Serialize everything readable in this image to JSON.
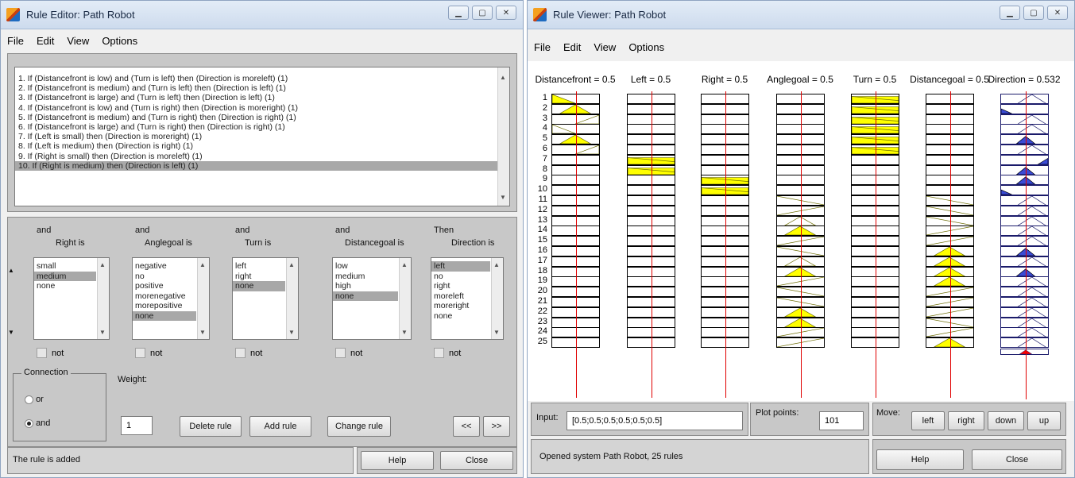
{
  "rule_editor": {
    "title": "Rule Editor: Path Robot",
    "menu": [
      "File",
      "Edit",
      "View",
      "Options"
    ],
    "rules": [
      "1. If (Distancefront is low) and (Turn is left) then (Direction is moreleft) (1)",
      "2. If (Distancefront is medium) and (Turn is left) then (Direction is left) (1)",
      "3. If (Distancefront is large) and (Turn is left) then (Direction is left) (1)",
      "4. If (Distancefront is low) and (Turn is right) then (Direction is moreright) (1)",
      "5. If (Distancefront is medium) and (Turn is right) then (Direction is right) (1)",
      "6. If (Distancefront is large) and (Turn is right) then (Direction is right) (1)",
      "7. If (Left is small) then (Direction is moreright) (1)",
      "8. If (Left is medium) then (Direction is right) (1)",
      "9. If (Right is small) then (Direction is moreleft) (1)",
      "10. If (Right is medium) then (Direction is left) (1)"
    ],
    "selected_rule": 9,
    "columns": [
      {
        "prefix": "and",
        "label": "Right is",
        "options": [
          "small",
          "medium",
          "none"
        ],
        "selected": 1,
        "not": "not"
      },
      {
        "prefix": "and",
        "label": "Anglegoal is",
        "options": [
          "negative",
          "no",
          "positive",
          "morenegative",
          "morepositive",
          "none"
        ],
        "selected": 5,
        "not": "not"
      },
      {
        "prefix": "and",
        "label": "Turn is",
        "options": [
          "left",
          "right",
          "none"
        ],
        "selected": 2,
        "not": "not"
      },
      {
        "prefix": "and",
        "label": "Distancegoal is",
        "options": [
          "low",
          "medium",
          "high",
          "none"
        ],
        "selected": 3,
        "not": "not"
      },
      {
        "prefix": "Then",
        "label": "Direction is",
        "options": [
          "left",
          "no",
          "right",
          "moreleft",
          "moreright",
          "none"
        ],
        "selected": 0,
        "not": "not"
      }
    ],
    "connection_label": "Connection",
    "connection_options": [
      "or",
      "and"
    ],
    "connection_selected": 1,
    "weight_label": "Weight:",
    "weight_value": "1",
    "buttons": {
      "delete": "Delete rule",
      "add": "Add rule",
      "change": "Change rule",
      "prev": "<<",
      "next": ">>",
      "help": "Help",
      "close": "Close"
    },
    "status": "The rule is added"
  },
  "rule_viewer": {
    "title": "Rule Viewer: Path Robot",
    "menu": [
      "File",
      "Edit",
      "View",
      "Options"
    ],
    "variables": [
      {
        "label": "Distancefront = 0.5",
        "input": 0.5
      },
      {
        "label": "Left = 0.5",
        "input": 0.5
      },
      {
        "label": "Right = 0.5",
        "input": 0.5
      },
      {
        "label": "Anglegoal = 0.5",
        "input": 0.5
      },
      {
        "label": "Turn = 0.5",
        "input": 0.5
      },
      {
        "label": "Distancegoal = 0.5",
        "input": 0.5
      },
      {
        "label": "Direction = 0.532",
        "input": 0.532
      }
    ],
    "rule_numbers": [
      "1",
      "2",
      "3",
      "4",
      "5",
      "6",
      "7",
      "8",
      "9",
      "10",
      "11",
      "12",
      "13",
      "14",
      "15",
      "16",
      "17",
      "18",
      "19",
      "20",
      "21",
      "22",
      "23",
      "24",
      "25"
    ],
    "input_label": "Input:",
    "input_value": "[0.5;0.5;0.5;0.5;0.5;0.5]",
    "plot_points_label": "Plot points:",
    "plot_points_value": "101",
    "move_label": "Move:",
    "move_buttons": [
      "left",
      "right",
      "down",
      "up"
    ],
    "status": "Opened system Path Robot, 25 rules",
    "help": "Help",
    "close": "Close",
    "colors": {
      "fill_input": "#ffff00",
      "fill_output": "#3a4bd6",
      "line": "#e00000",
      "aggregate": "#ff0000"
    }
  }
}
